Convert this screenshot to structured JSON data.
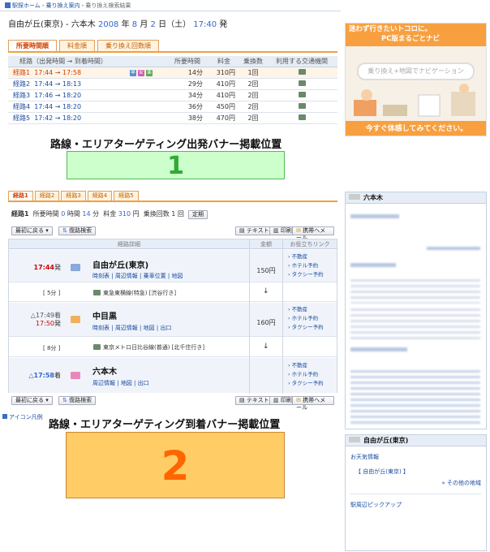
{
  "breadcrumb": [
    "駅探ホーム",
    "乗り換え案内",
    "乗り換え検索結果"
  ],
  "route_header": {
    "from": "自由が丘(東京)",
    "sep": " - ",
    "to": "六本木",
    "year": "2008",
    "year_unit": " 年 ",
    "month": "8",
    "month_unit": " 月 ",
    "day": "2",
    "day_unit": " 日（土） ",
    "time": "17:40",
    "suffix": " 発"
  },
  "top_tabs": [
    "所要時間順",
    "料金順",
    "乗り換え回数順"
  ],
  "summary_table": {
    "headers": [
      "経路（出発時間 → 到着時間）",
      "所要時間",
      "料金",
      "乗換数",
      "利用する交通機関"
    ],
    "rows": [
      {
        "route": "経路1",
        "times": "17:44 → 17:58",
        "duration": "14分",
        "fare": "310円",
        "transfers": "1回",
        "badges": [
          "早",
          "安",
          "楽"
        ]
      },
      {
        "route": "経路2",
        "times": "17:44 → 18:13",
        "duration": "29分",
        "fare": "410円",
        "transfers": "2回"
      },
      {
        "route": "経路3",
        "times": "17:46 → 18:20",
        "duration": "34分",
        "fare": "410円",
        "transfers": "2回"
      },
      {
        "route": "経路4",
        "times": "17:44 → 18:20",
        "duration": "36分",
        "fare": "450円",
        "transfers": "2回"
      },
      {
        "route": "経路5",
        "times": "17:42 → 18:20",
        "duration": "38分",
        "fare": "470円",
        "transfers": "2回"
      }
    ]
  },
  "banner1": {
    "label": "路線・エリアターゲティング出発バナー掲載位置",
    "number": "1"
  },
  "route_tabs": [
    "経路1",
    "経路2",
    "経路3",
    "経路4",
    "経路5"
  ],
  "route_summary": {
    "route": "経路1",
    "label_time": "所要時間",
    "hours": "0",
    "hour_unit": " 時間 ",
    "minutes": "14",
    "minute_unit": " 分",
    "label_fare": "料金",
    "fare": "310",
    "fare_unit": " 円",
    "label_transfers": "乗換回数",
    "transfers": "1",
    "transfers_unit": " 回",
    "teiki": "定期"
  },
  "toolbar": {
    "back": "最初に戻る",
    "reverse": "復路検索",
    "text": "テキスト",
    "print": "印刷",
    "mobile": "携帯へメール"
  },
  "detail_headers": {
    "route_detail": "経路詳細",
    "fare": "金額",
    "links": "お役立ちリンク"
  },
  "stations": [
    {
      "time": "17:44",
      "time_suffix": "発",
      "name": "自由が丘(東京)",
      "links": [
        "時刻表",
        "周辺情報",
        "乗車位置",
        "地図"
      ],
      "fare": "150円",
      "useful": [
        "不動産",
        "ホテル予約",
        "タクシー予約"
      ]
    },
    {
      "time_arr": "17:49",
      "arr_suffix": "着",
      "time_dep": "17:50",
      "dep_suffix": "発",
      "name": "中目黒",
      "links": [
        "時刻表",
        "周辺情報",
        "地図",
        "出口"
      ],
      "fare": "160円",
      "useful": [
        "不動産",
        "ホテル予約",
        "タクシー予約"
      ]
    },
    {
      "time": "17:58",
      "time_suffix": "着",
      "name": "六本木",
      "links": [
        "周辺情報",
        "地図",
        "出口"
      ],
      "useful": [
        "不動産",
        "ホテル予約",
        "タクシー予約"
      ]
    }
  ],
  "segments": [
    {
      "duration": "[ 5分 ]",
      "line": "東急東横線(特急) [渋谷行き]",
      "arrow": "↓"
    },
    {
      "duration": "[ 8分 ]",
      "line": "東京メトロ日比谷線(普通) [北千住行き]",
      "arrow": "↓"
    }
  ],
  "icon_legend": "アイコン凡例",
  "banner2": {
    "label": "路線・エリアターゲティング到着バナー掲載位置",
    "number": "2"
  },
  "ad": {
    "title_line1": "迷わず行きたいトコロに。",
    "title_line2": "PC版まるごとナビ",
    "bubble": "乗り換え+地図でナビゲーション",
    "footer": "今すぐ体感してみてください。"
  },
  "side_dest": {
    "name": "六本木"
  },
  "side_origin": {
    "name": "自由が丘(東京)",
    "weather": "お天気情報",
    "weather_link": "【 自由が丘(東京) 】",
    "other_area": "» その他の地域",
    "pickup": "駅周辺ピックアップ"
  }
}
